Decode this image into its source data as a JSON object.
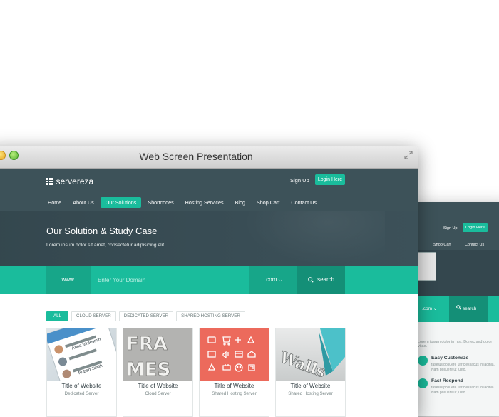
{
  "window": {
    "title": "Web Screen Presentation"
  },
  "site": {
    "logo": "servereza",
    "header": {
      "signup_label": "Sign Up",
      "login_label": "Login Here"
    },
    "nav": [
      {
        "label": "Home",
        "active": false
      },
      {
        "label": "About Us",
        "active": false
      },
      {
        "label": "Our Solutions",
        "active": true
      },
      {
        "label": "Shortcodes",
        "active": false
      },
      {
        "label": "Hosting Services",
        "active": false
      },
      {
        "label": "Blog",
        "active": false
      },
      {
        "label": "Shop Cart",
        "active": false
      },
      {
        "label": "Contact Us",
        "active": false
      }
    ],
    "hero": {
      "title": "Our Solution & Study Case",
      "subtitle": "Lorem ipsum dolor sit amet, consectetur adipisicing elit."
    },
    "search": {
      "prefix": "www.",
      "placeholder": "Enter Your Domain",
      "tld": ".com",
      "button_label": "search"
    },
    "filters": [
      {
        "label": "ALL",
        "active": true
      },
      {
        "label": "CLOUD SERVER",
        "active": false
      },
      {
        "label": "DEDICATED SERVER",
        "active": false
      },
      {
        "label": "SHARED HOSTING SERVER",
        "active": false
      }
    ],
    "cards": [
      {
        "title": "Title of Website",
        "subtitle": "Dedicated Server",
        "thumb_words": [
          "Contacts",
          "Anna Birdesmin",
          "Robert Smith"
        ]
      },
      {
        "title": "Title of Website",
        "subtitle": "Cloud Server",
        "thumb_words": [
          "FRA",
          "MES"
        ]
      },
      {
        "title": "Title of Website",
        "subtitle": "Shared Hosting Server",
        "thumb_words": []
      },
      {
        "title": "Title of Website",
        "subtitle": "Shared Hosting Server",
        "thumb_words": [
          "Walls"
        ]
      }
    ]
  },
  "background_window": {
    "signup_label": "Sign Up",
    "login_label": "Login Here",
    "nav": [
      "Shop Cart",
      "Contact Us"
    ],
    "tld": ".com",
    "search_label": "search",
    "intro_text": "Lorem ipsum dolor in nisl. Donec sed dolor vitae.",
    "features": [
      {
        "title": "Easy Customize",
        "desc": "faselus posuere ultricies lacus in lacinia. Nam posuere ut justo."
      },
      {
        "title": "Fast Respond",
        "desc": "faselus posuere ultricies lacus in lacinia. Nam posuere ut justo."
      }
    ]
  },
  "colors": {
    "accent": "#1abc9c",
    "accent_dark": "#148f77",
    "header": "#3d5259"
  }
}
